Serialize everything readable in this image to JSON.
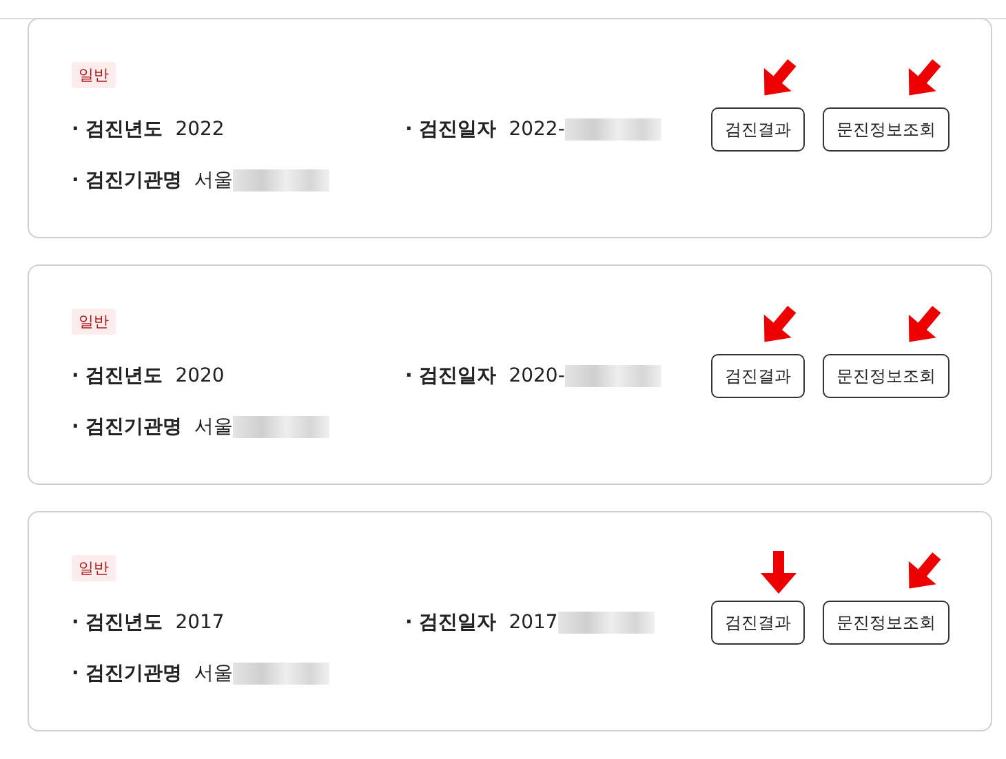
{
  "cards": [
    {
      "badge": "일반",
      "fields": [
        {
          "label": "· 검진년도",
          "value": "2022",
          "redacted": false
        },
        {
          "label": "· 검진일자",
          "value": "2022-",
          "redacted": true
        },
        {
          "label": "· 검진기관명",
          "value": "서울",
          "redacted": true
        }
      ],
      "buttons": [
        {
          "label": "검진결과",
          "kind": "diagonal-arrow"
        },
        {
          "label": "문진정보조회",
          "kind": "diagonal-arrow"
        }
      ]
    },
    {
      "badge": "일반",
      "fields": [
        {
          "label": "· 검진년도",
          "value": "2020",
          "redacted": false
        },
        {
          "label": "· 검진일자",
          "value": "2020-",
          "redacted": true
        },
        {
          "label": "· 검진기관명",
          "value": "서울",
          "redacted": true
        }
      ],
      "buttons": [
        {
          "label": "검진결과",
          "kind": "diagonal-arrow"
        },
        {
          "label": "문진정보조회",
          "kind": "diagonal-arrow"
        }
      ]
    },
    {
      "badge": "일반",
      "fields": [
        {
          "label": "· 검진년도",
          "value": "2017",
          "redacted": false
        },
        {
          "label": "· 검진일자",
          "value": "2017",
          "redacted": true
        },
        {
          "label": "· 검진기관명",
          "value": "서울",
          "redacted": true
        }
      ],
      "buttons": [
        {
          "label": "검진결과",
          "kind": "down-arrow"
        },
        {
          "label": "문진정보조회",
          "kind": "diagonal-arrow"
        }
      ]
    }
  ]
}
